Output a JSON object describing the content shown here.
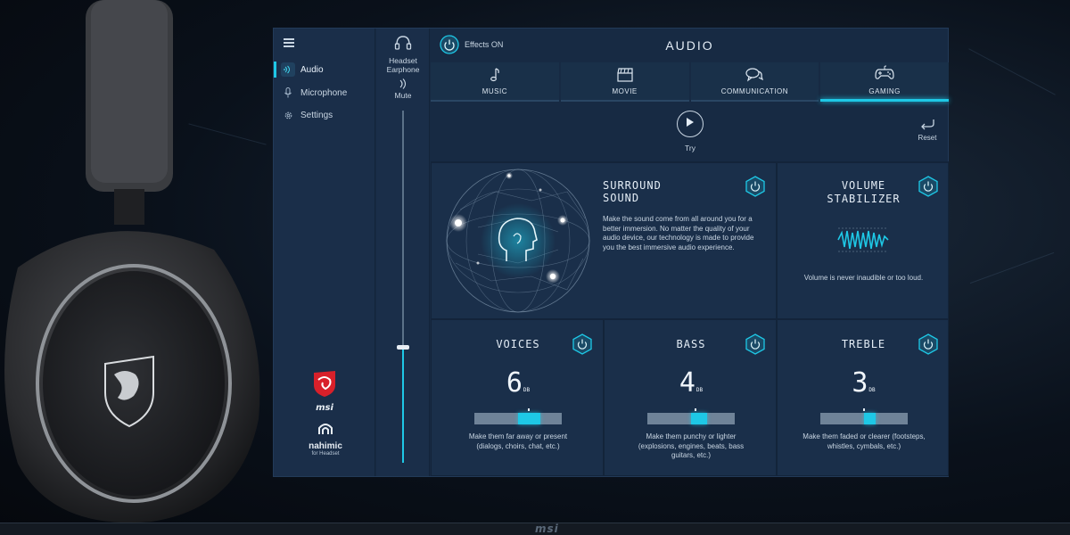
{
  "sidebar": {
    "items": [
      {
        "label": "Audio",
        "icon": "audio-waves-icon",
        "active": true
      },
      {
        "label": "Microphone",
        "icon": "microphone-icon",
        "active": false
      },
      {
        "label": "Settings",
        "icon": "gear-icon",
        "active": false
      }
    ],
    "brand_msi": "msi",
    "brand_nahimic": "nahimic",
    "brand_nahimic_sub": "for Headset"
  },
  "device": {
    "line1": "Headset",
    "line2": "Earphone",
    "mute_label": "Mute",
    "volume_fraction": 0.33
  },
  "header": {
    "effects_label": "Effects ON",
    "title": "AUDIO"
  },
  "tabs": [
    {
      "label": "MUSIC",
      "icon": "music-note-icon",
      "active": false
    },
    {
      "label": "MOVIE",
      "icon": "clapperboard-icon",
      "active": false
    },
    {
      "label": "COMMUNICATION",
      "icon": "chat-bubbles-icon",
      "active": false
    },
    {
      "label": "GAMING",
      "icon": "gamepad-icon",
      "active": true
    }
  ],
  "controls": {
    "try_label": "Try",
    "reset_label": "Reset"
  },
  "surround": {
    "title": "SURROUND SOUND",
    "desc": "Make the sound come from all around you for a better immersion. No matter the quality of your audio device, our technology is made to provide you the best immersive audio experience."
  },
  "stabilizer": {
    "title_line1": "VOLUME",
    "title_line2": "STABILIZER",
    "desc": "Volume is never inaudible or too loud."
  },
  "eq": [
    {
      "name": "VOICES",
      "value": "6",
      "unit": "DB",
      "fill_start": 0.5,
      "fill_end": 0.76,
      "desc": "Make them far away or present (dialogs, choirs, chat, etc.)"
    },
    {
      "name": "BASS",
      "value": "4",
      "unit": "DB",
      "fill_start": 0.5,
      "fill_end": 0.68,
      "desc": "Make them punchy or lighter (explosions, engines, beats, bass guitars, etc.)"
    },
    {
      "name": "TREBLE",
      "value": "3",
      "unit": "DB",
      "fill_start": 0.5,
      "fill_end": 0.63,
      "desc": "Make them faded or clearer (footsteps, whistles, cymbals, etc.)"
    }
  ],
  "colors": {
    "accent": "#1ec8e6",
    "panel": "#1a2f4a",
    "window": "#172a43"
  },
  "footer_logo": "msi"
}
